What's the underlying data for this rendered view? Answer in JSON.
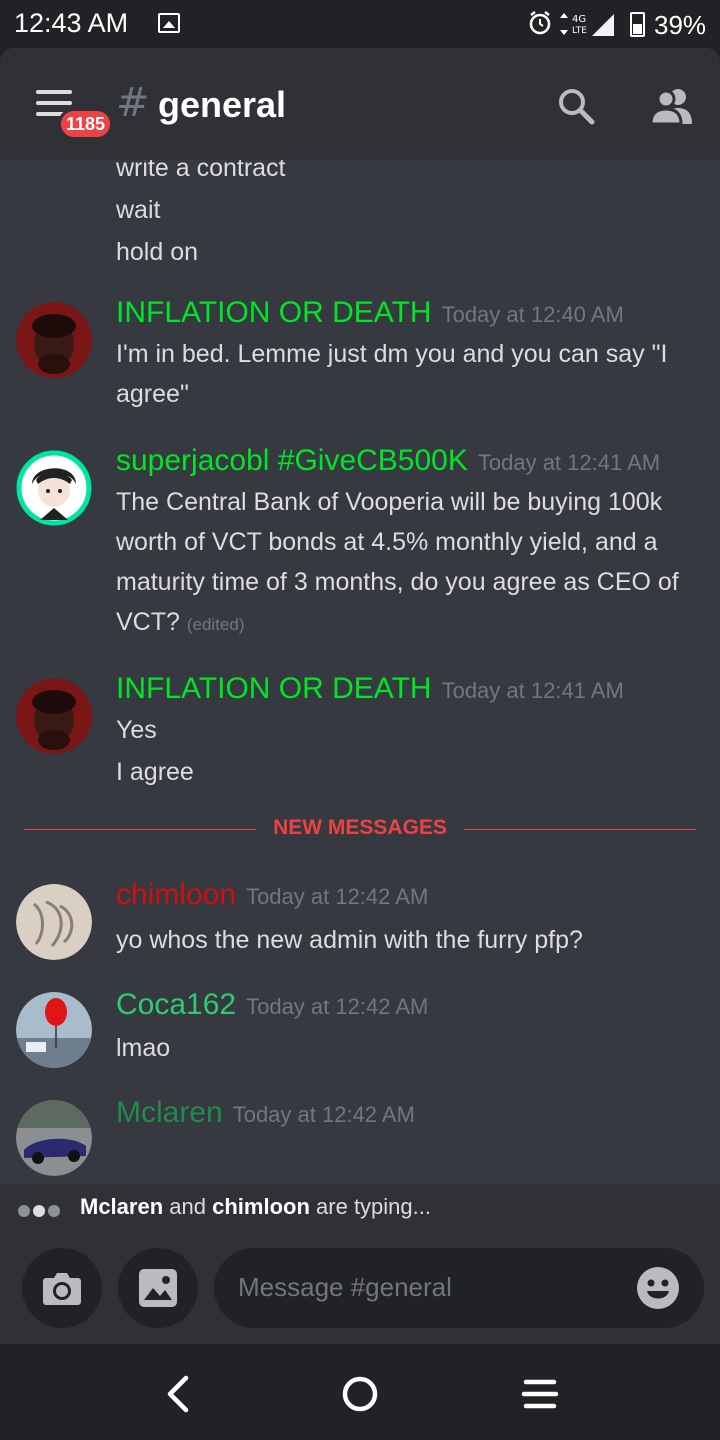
{
  "status_bar": {
    "time": "12:43 AM",
    "network": "4G",
    "network_sub": "LTE",
    "battery": "39%",
    "battery_level": 0.39
  },
  "header": {
    "badge_count": "1185",
    "hash": "#",
    "channel_name": "general"
  },
  "continuation": [
    "write a contract",
    "wait",
    "hold on"
  ],
  "messages": [
    {
      "author": "INFLATION OR DEATH",
      "author_color": "#00e626",
      "timestamp": "Today at 12:40 AM",
      "lines": [
        "I'm in bed. Lemme just dm you and you can say \"I agree\""
      ]
    },
    {
      "author": "superjacobl #GiveCB500K",
      "author_color": "#00e626",
      "timestamp": "Today at 12:41 AM",
      "text": "The Central Bank of Vooperia will be buying 100k worth of VCT bonds at 4.5% monthly yield, and a maturity time of 3 months, do you agree as CEO of VCT?",
      "edited": "(edited)"
    },
    {
      "author": "INFLATION OR DEATH",
      "author_color": "#00e626",
      "timestamp": "Today at 12:41 AM",
      "lines": [
        "Yes",
        "I agree"
      ]
    },
    {
      "author": "chimloon",
      "author_color": "#d01010",
      "timestamp": "Today at 12:42 AM",
      "lines": [
        "yo whos the new admin with the furry pfp?"
      ]
    },
    {
      "author": "Coca162",
      "author_color": "#2ecc71",
      "timestamp": "Today at 12:42 AM",
      "lines": [
        "lmao"
      ]
    },
    {
      "author": "Mclaren",
      "author_color": "#1f8b4c",
      "timestamp": "Today at 12:42 AM",
      "lines": []
    }
  ],
  "divider": {
    "label": "NEW MESSAGES",
    "color": "#ed4245"
  },
  "typing": {
    "user1": "Mclaren",
    "joiner": "and",
    "user2": "chimloon",
    "suffix": "are typing..."
  },
  "composer": {
    "placeholder": "Message #general"
  },
  "icons": {
    "menu": "hamburger-menu-icon",
    "search": "search-icon",
    "members": "members-icon",
    "camera": "camera-icon",
    "gallery": "image-icon",
    "emoji": "emoji-icon",
    "back": "back-icon",
    "home": "home-icon",
    "recents": "recents-icon"
  }
}
